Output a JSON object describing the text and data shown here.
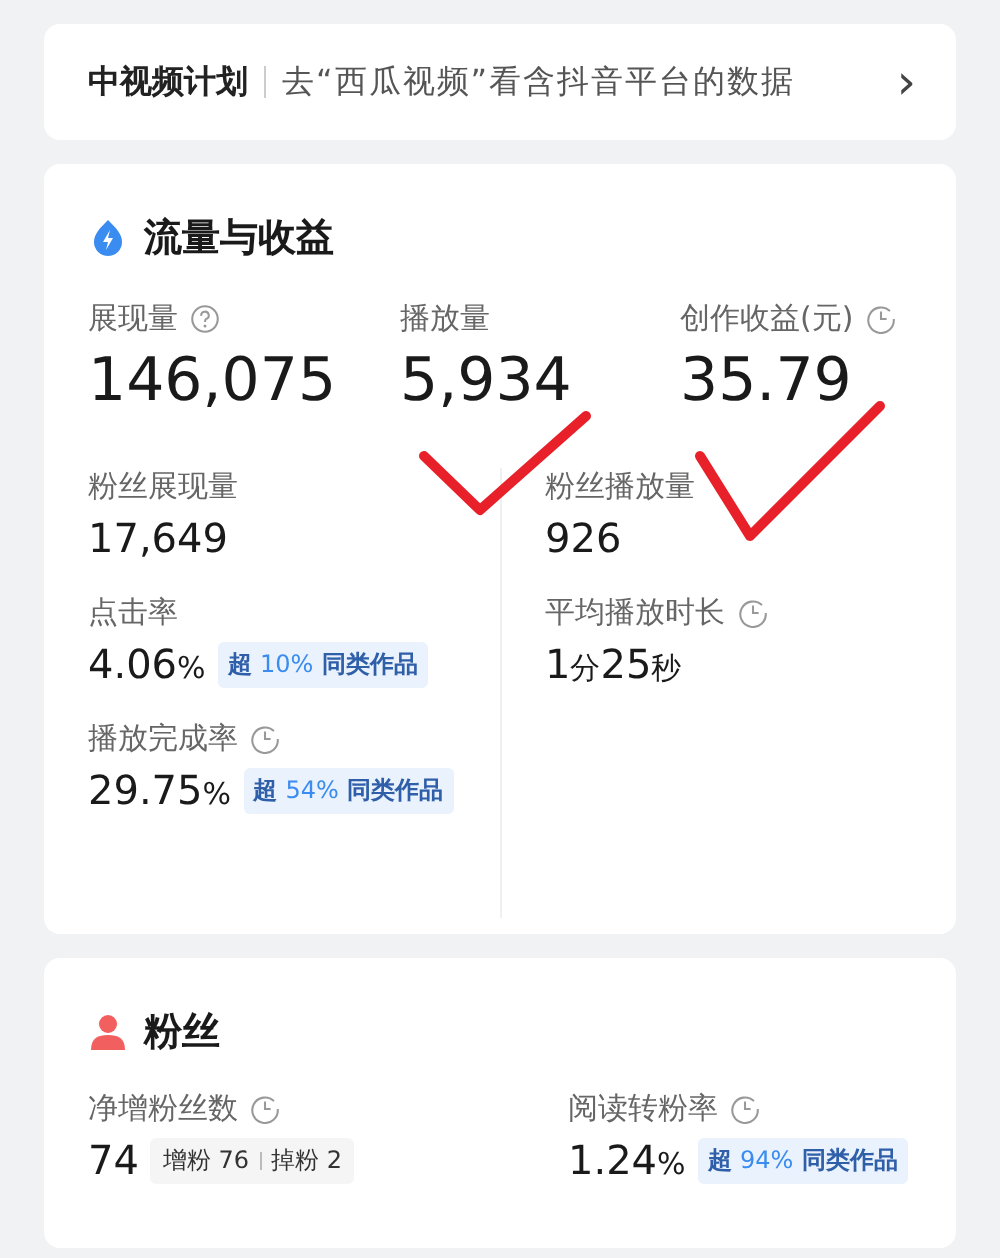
{
  "plan_banner": {
    "title": "中视频计划",
    "link": "去“西瓜视频”看含抖音平台的数据",
    "chevron": "›"
  },
  "traffic": {
    "title": "流量与收益",
    "top_metrics": [
      {
        "label": "展现量",
        "kind": "with_help",
        "value": "146,075"
      },
      {
        "label": "播放量",
        "kind": "plain",
        "value": "5,934"
      },
      {
        "label": "创作收益(元)",
        "kind": "with_clock",
        "value": "35.79"
      }
    ],
    "columns": [
      [
        {
          "label": "粉丝展现量",
          "kind": "plain",
          "value_parts": [
            {
              "text": "17,649",
              "kind": "number"
            }
          ]
        },
        {
          "label": "点击率",
          "kind": "plain",
          "value_parts": [
            {
              "text": "4.06",
              "kind": "number"
            },
            {
              "text": "%",
              "kind": "unit"
            }
          ],
          "badge": {
            "prefix": "超",
            "percent": "10%",
            "suffix": "同类作品"
          }
        },
        {
          "label": "播放完成率",
          "kind": "with_clock",
          "value_parts": [
            {
              "text": "29.75",
              "kind": "number"
            },
            {
              "text": "%",
              "kind": "unit"
            }
          ],
          "badge": {
            "prefix": "超",
            "percent": "54%",
            "suffix": "同类作品"
          }
        }
      ],
      [
        {
          "label": "粉丝播放量",
          "kind": "plain",
          "value_parts": [
            {
              "text": "926",
              "kind": "number"
            }
          ]
        },
        {
          "label": "平均播放时长",
          "kind": "with_clock",
          "value_parts": [
            {
              "text": "1",
              "kind": "number"
            },
            {
              "text": "分",
              "kind": "unit"
            },
            {
              "text": "25",
              "kind": "number"
            },
            {
              "text": "秒",
              "kind": "unit"
            }
          ]
        }
      ]
    ]
  },
  "annotations": [
    {
      "kind": "checkmark"
    },
    {
      "kind": "checkmark"
    }
  ],
  "fans": {
    "title": "粉丝",
    "metrics": [
      {
        "label": "净增粉丝数",
        "kind": "with_clock",
        "value_parts": [
          {
            "text": "74",
            "kind": "number"
          }
        ],
        "breakdown": [
          {
            "label": "增粉",
            "value": "76"
          },
          {
            "label": "掉粉",
            "value": "2"
          }
        ]
      },
      {
        "label": "阅读转粉率",
        "kind": "with_clock",
        "value_parts": [
          {
            "text": "1.24",
            "kind": "number"
          },
          {
            "text": "%",
            "kind": "unit"
          }
        ],
        "badge": {
          "prefix": "超",
          "percent": "94%",
          "suffix": "同类作品"
        }
      }
    ]
  }
}
